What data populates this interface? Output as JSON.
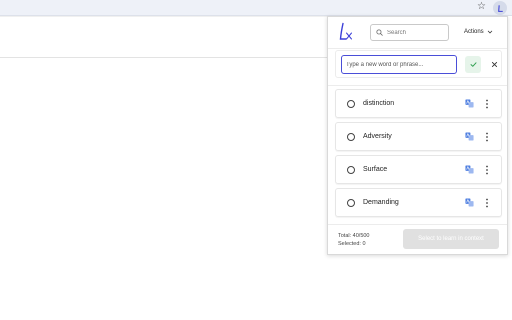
{
  "browser": {
    "bookmark_icon": "star-icon",
    "extension_icon": "lex-extension-icon"
  },
  "popup": {
    "logo": {
      "letters": "Lx",
      "accent": "#3b3fd8"
    },
    "search": {
      "placeholder": "Search",
      "icon": "search-icon"
    },
    "actions": {
      "label": "Actions",
      "icon": "chevron-down-icon"
    },
    "add_word": {
      "placeholder": "Type a new word or phrase...",
      "value": "",
      "confirm_icon": "check-icon",
      "cancel_icon": "close-icon"
    },
    "words": [
      {
        "label": "distinction",
        "selected": false
      },
      {
        "label": "Adversity",
        "selected": false
      },
      {
        "label": "Surface",
        "selected": false
      },
      {
        "label": "Demanding",
        "selected": false
      }
    ],
    "footer": {
      "total": "Total: 40/500",
      "selected": "Selected: 0",
      "learn_button": "Select to learn in context",
      "learn_button_disabled": true
    }
  },
  "colors": {
    "accent": "#4a4ed8",
    "confirm_bg": "#e6f4ea",
    "confirm_check": "#2e9e4f",
    "translate_icon": "#4f7fe0",
    "disabled_button": "#e0e0e0"
  }
}
